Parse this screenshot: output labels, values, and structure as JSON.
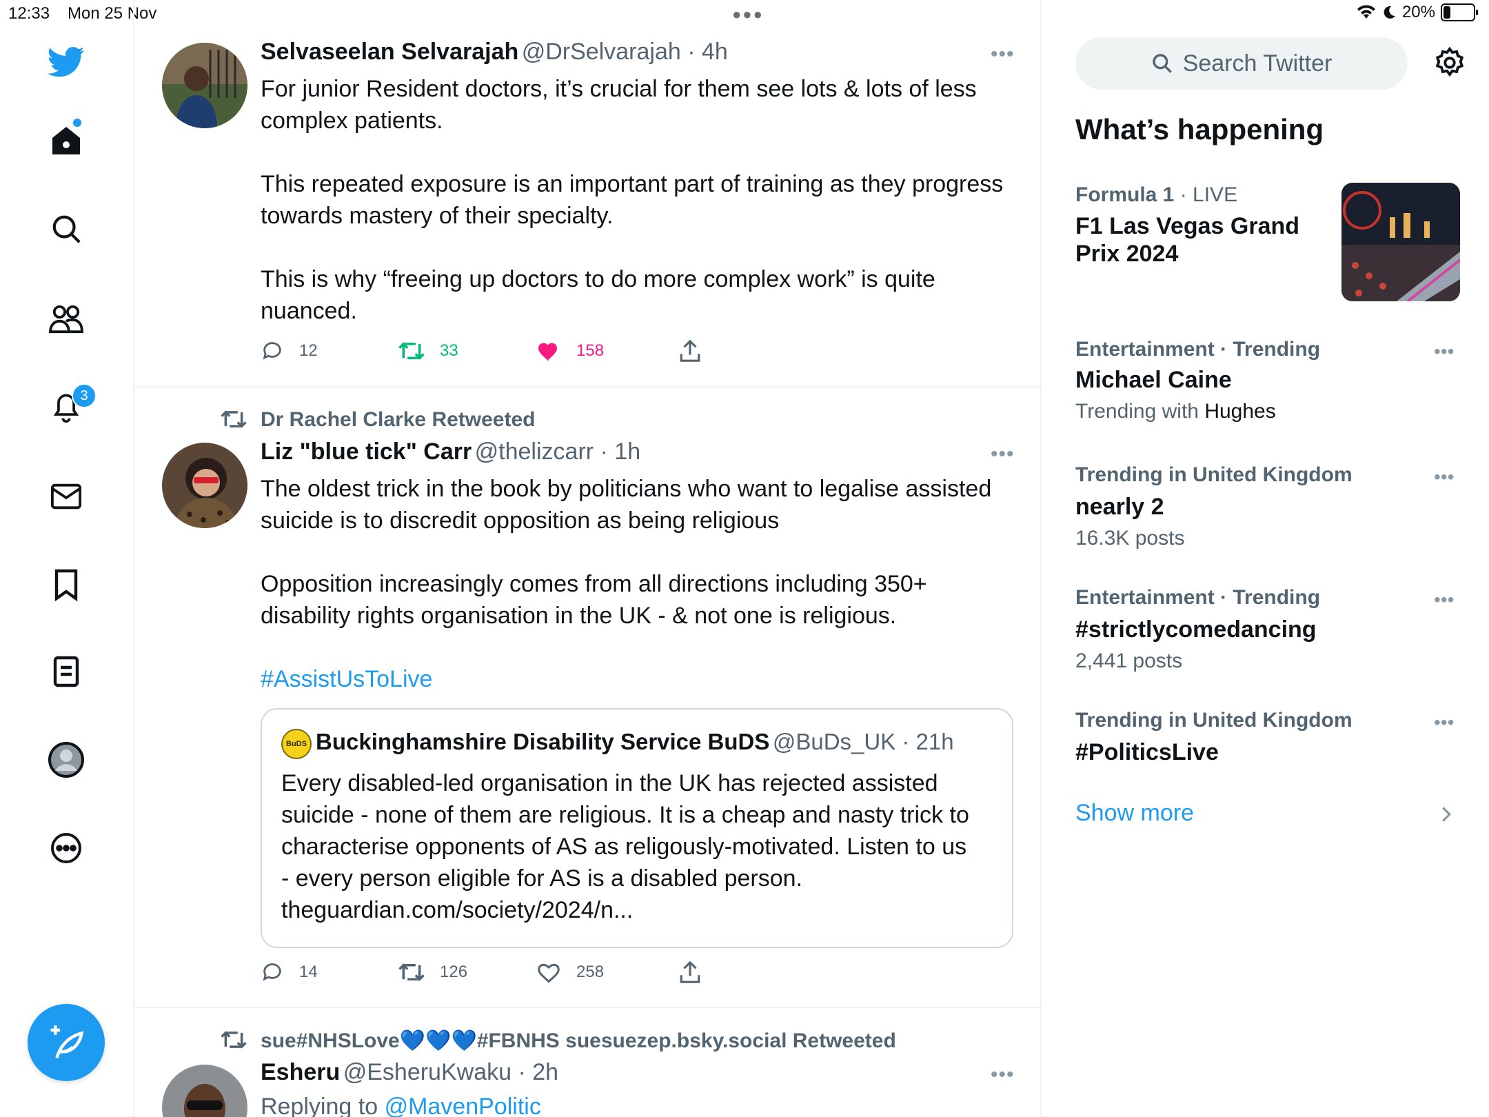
{
  "status": {
    "time": "12:33",
    "date": "Mon 25 Nov",
    "battery": "20%"
  },
  "nav": {
    "notifications_badge": "3"
  },
  "tweets": [
    {
      "name": "Selvaseelan Selvarajah",
      "handle": "@DrSelvarajah · 4h",
      "text": "For junior Resident doctors, it’s crucial for them see lots & lots of less\ncomplex patients.\n\nThis repeated exposure is an important part of training as they progress\ntowards mastery of their specialty.\n\nThis is why “freeing up doctors to do more complex work” is quite\nnuanced.",
      "replies": "12",
      "retweets": "33",
      "likes": "158"
    },
    {
      "retweeted_by": "Dr Rachel Clarke Retweeted",
      "name": "Liz \"blue tick\" Carr",
      "handle": "@thelizcarr · 1h",
      "text": "The oldest trick in the book by politicians who want to legalise assisted\nsuicide is to discredit opposition as being religious\n\nOpposition increasingly comes from all directions including 350+\ndisability rights organisation in the UK - & not one is religious.",
      "hashtag": "#AssistUsToLive",
      "quote": {
        "avatar_text": "BuDS",
        "name": "Buckinghamshire Disability Service BuDS",
        "handle": "@BuDs_UK · 21h",
        "text": "Every disabled-led organisation in the UK has rejected assisted\nsuicide - none of them are religious. It is a cheap and nasty trick to\ncharacterise opponents of AS as religously-motivated. Listen to us\n- every person eligible for AS is a disabled person.\ntheguardian.com/society/2024/n..."
      },
      "replies": "14",
      "retweets": "126",
      "likes": "258"
    },
    {
      "retweeted_by": "sue#NHSLove💙💙💙#FBNHS suesuezep.bsky.social Retweeted",
      "name": "Esheru",
      "handle": "@EsheruKwaku · 2h",
      "replying_prefix": "Replying to",
      "replying_to": "@MavenPolitic"
    }
  ],
  "sidebar": {
    "search_placeholder": "Search Twitter",
    "heading": "What’s happening",
    "trends": [
      {
        "meta_bold": "Formula 1",
        "meta": " · LIVE",
        "title": "F1 Las Vegas Grand\nPrix 2024"
      },
      {
        "meta": "Entertainment · Trending",
        "title": "Michael Caine",
        "sub_prefix": "Trending with ",
        "sub_strong": "Hughes"
      },
      {
        "meta": "Trending in United Kingdom",
        "title": "nearly 2",
        "sub": "16.3K posts"
      },
      {
        "meta": "Entertainment · Trending",
        "title": "#strictlycomedancing",
        "sub": "2,441 posts"
      },
      {
        "meta": "Trending in United Kingdom",
        "title": "#PoliticsLive"
      }
    ],
    "show_more": "Show more"
  },
  "colors": {
    "accent": "#1d9bf0",
    "retweet_green": "#00ba7c",
    "like_pink": "#f91880",
    "muted": "#536471"
  }
}
